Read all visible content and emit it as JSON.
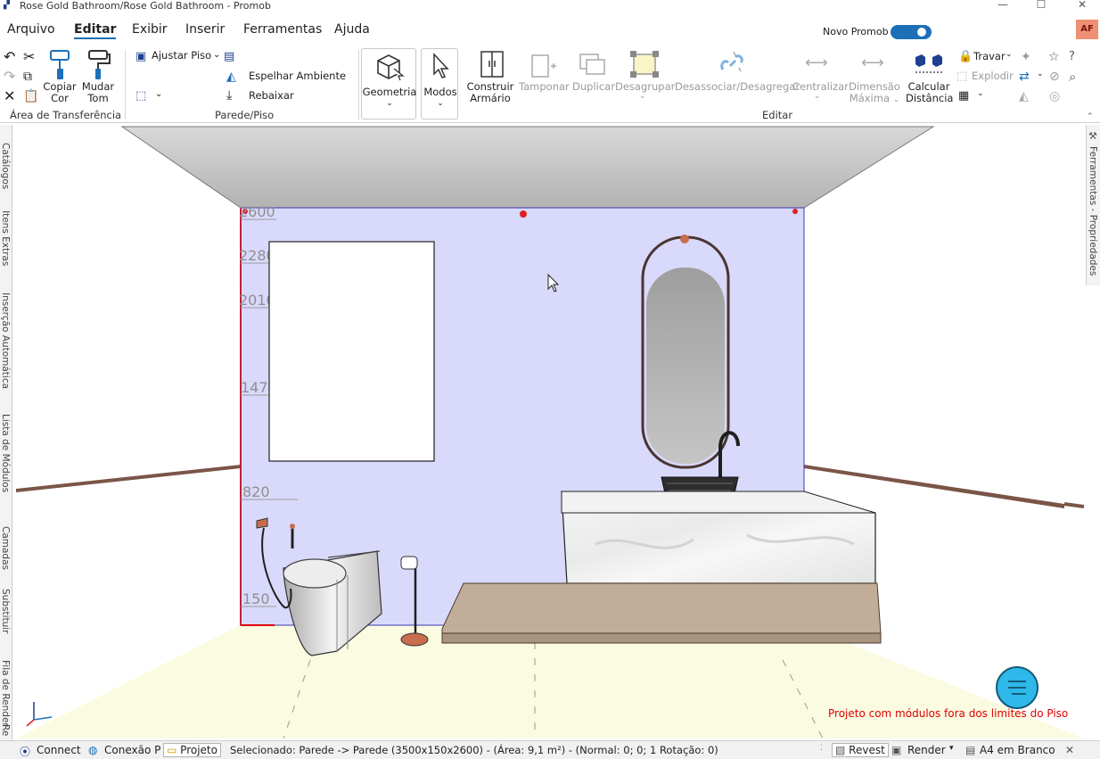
{
  "window": {
    "title": "Rose Gold Bathroom/Rose Gold Bathroom - Promob",
    "minimize": "—",
    "maximize": "☐",
    "close": "✕"
  },
  "menu": {
    "items": [
      "Arquivo",
      "Editar",
      "Exibir",
      "Inserir",
      "Ferramentas",
      "Ajuda"
    ],
    "active": "Editar",
    "novo_promob": "Novo Promob",
    "avatar": "AF"
  },
  "ribbon": {
    "clipboard": {
      "copiar_cor": [
        "Copiar",
        "Cor"
      ],
      "mudar_tom": [
        "Mudar",
        "Tom"
      ],
      "group": "Área de Transferência"
    },
    "parede_piso": {
      "ajustar_piso": "Ajustar Piso",
      "espelhar_ambiente": "Espelhar Ambiente",
      "rebaixar": "Rebaixar",
      "group": "Parede/Piso"
    },
    "geometria": "Geometria",
    "modos": "Modos",
    "editar": {
      "construir_armario": [
        "Construir",
        "Armário"
      ],
      "tamponar": "Tamponar",
      "duplicar": "Duplicar",
      "desagrupar": "Desagrupar",
      "desassociar": "Desassociar/Desagregar",
      "centralizar": "Centralizar",
      "dimensao_maxima": [
        "Dimensão",
        "Máxima"
      ],
      "calcular_distancia": [
        "Calcular",
        "Distância"
      ],
      "travar": "Travar",
      "explodir": "Explodir",
      "group": "Editar"
    }
  },
  "side_tabs": {
    "left": [
      "Catálogos",
      "Itens Extras",
      "Inserção Automática",
      "Lista de Módulos",
      "Camadas",
      "Substituir",
      "Fila de Render",
      "Re"
    ],
    "right": [
      "Ferramentas - Propriedades"
    ]
  },
  "viewport": {
    "dimension_labels": [
      "2600",
      "2280",
      "2010",
      "1470",
      "820",
      "150"
    ],
    "warning": "Projeto com módulos fora dos limites do Piso",
    "colors": {
      "wall": "#d9d9fb",
      "floor": "#fbfbe2",
      "ceiling": "#bfbfbf",
      "warning": "#e00000"
    }
  },
  "statusbar": {
    "connect": "Connect",
    "conexao": "Conexão P",
    "projeto": "Projeto",
    "selected": "Selecionado: Parede -> Parede (3500x150x2600) - (Área: 9,1 m²) - (Normal: 0; 0; 1 Rotação: 0)",
    "revest": "Revest",
    "render": "Render",
    "a4": "A4 em Branco"
  }
}
